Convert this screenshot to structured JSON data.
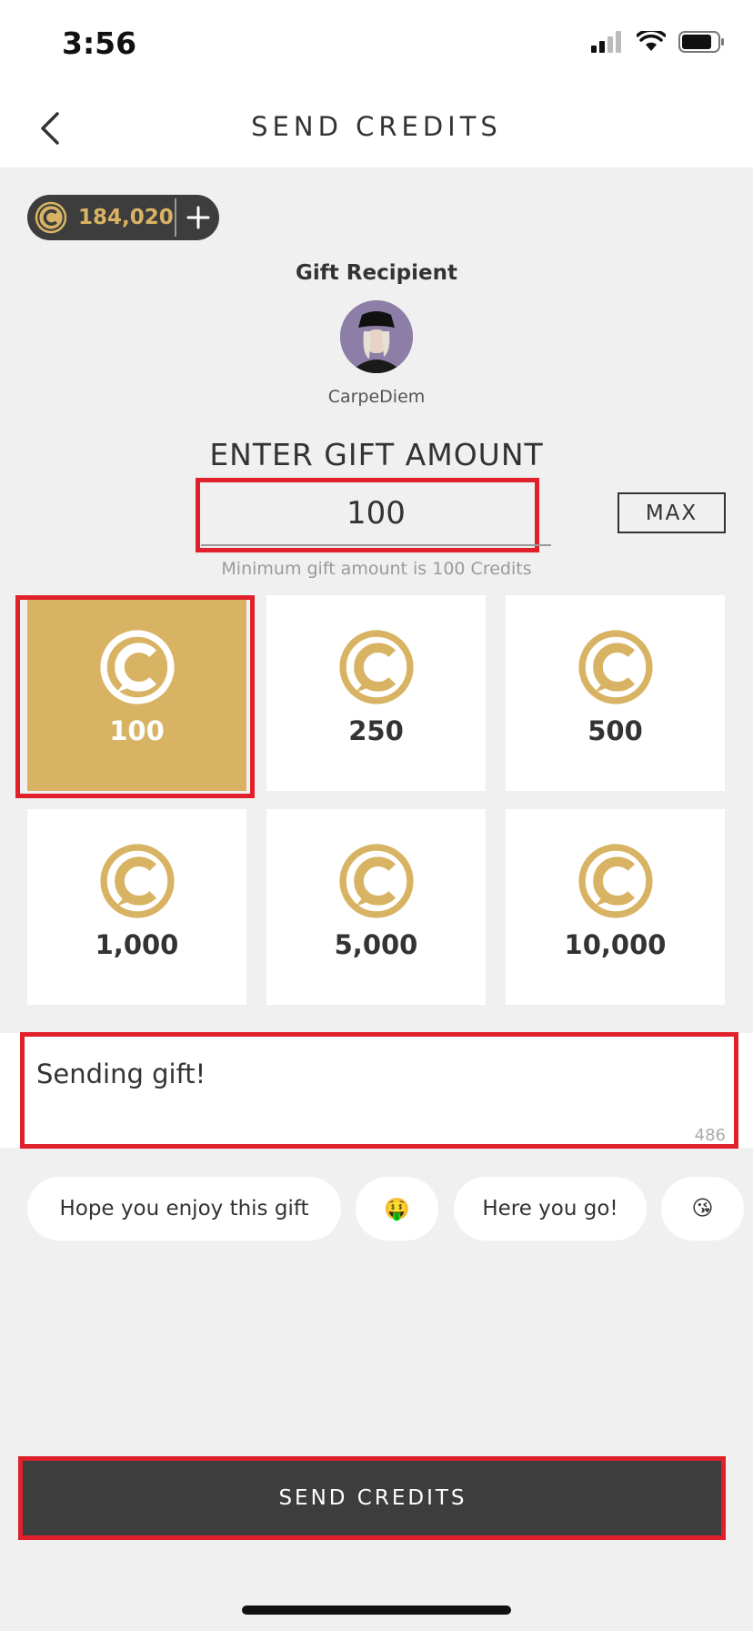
{
  "status_bar": {
    "time": "3:56"
  },
  "nav": {
    "title": "SEND CREDITS"
  },
  "balance": {
    "value": "184,020"
  },
  "recipient": {
    "label": "Gift Recipient",
    "name": "CarpeDiem"
  },
  "amount": {
    "heading": "ENTER GIFT AMOUNT",
    "value": "100",
    "max_label": "MAX",
    "min_note": "Minimum gift amount is 100 Credits"
  },
  "presets": [
    {
      "label": "100",
      "selected": true
    },
    {
      "label": "250",
      "selected": false
    },
    {
      "label": "500",
      "selected": false
    },
    {
      "label": "1,000",
      "selected": false
    },
    {
      "label": "5,000",
      "selected": false
    },
    {
      "label": "10,000",
      "selected": false
    }
  ],
  "message": {
    "text": "Sending gift!",
    "remaining": "486"
  },
  "quick_replies": [
    "Hope you enjoy this gift",
    "🤑",
    "Here you go!",
    "😘"
  ],
  "send_button": {
    "label": "SEND CREDITS"
  },
  "colors": {
    "accent_gold": "#d8b363",
    "dark": "#3d3d3d",
    "highlight_red": "#e0202a"
  }
}
